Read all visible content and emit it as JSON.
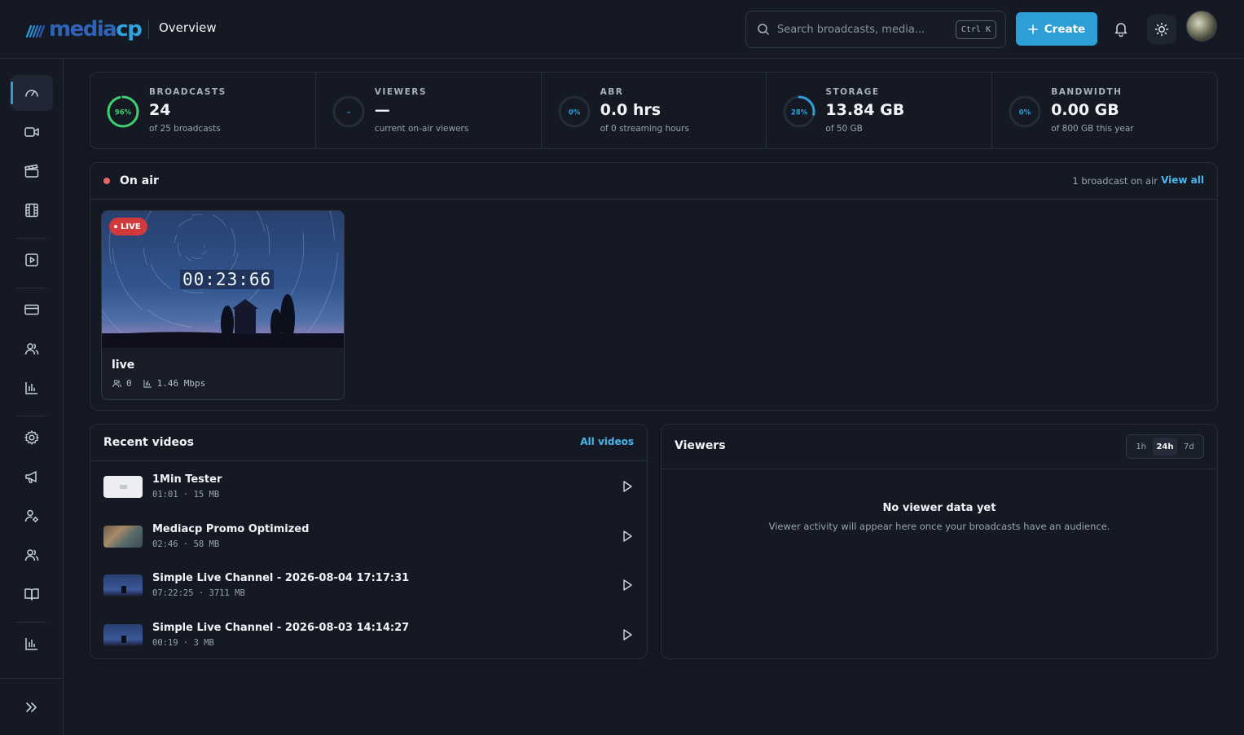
{
  "header": {
    "logo": {
      "part1": "media",
      "part2": "cp"
    },
    "title": "Overview",
    "search_placeholder": "Search broadcasts, media...",
    "shortcut": "Ctrl K",
    "create_label": "Create"
  },
  "sidebar": {
    "items": [
      {
        "icon": "gauge-icon",
        "active": true
      },
      {
        "icon": "video-camera-icon"
      },
      {
        "icon": "clapperboard-icon"
      },
      {
        "icon": "film-icon"
      },
      {
        "icon": "play-square-icon"
      },
      {
        "icon": "credit-card-icon"
      },
      {
        "icon": "users-icon"
      },
      {
        "icon": "bar-chart-icon"
      },
      {
        "icon": "gear-icon"
      },
      {
        "icon": "megaphone-icon"
      },
      {
        "icon": "user-cog-icon"
      },
      {
        "icon": "users-icon"
      },
      {
        "icon": "book-icon"
      },
      {
        "icon": "bar-chart-icon"
      }
    ],
    "collapse_icon": "chevrons-right-icon"
  },
  "stats": [
    {
      "label": "BROADCASTS",
      "value": "24",
      "sub": "of 25 broadcasts",
      "ring": "96%",
      "fraction": 0.96,
      "color": "#3ecf6e"
    },
    {
      "label": "VIEWERS",
      "value": "—",
      "sub": "current on-air viewers",
      "ring": "–",
      "fraction": 0,
      "color": "#2e9fd6"
    },
    {
      "label": "ABR",
      "value": "0.0 hrs",
      "sub": "of 0 streaming hours",
      "ring": "0%",
      "fraction": 0,
      "color": "#2e9fd6"
    },
    {
      "label": "STORAGE",
      "value": "13.84 GB",
      "sub": "of 50 GB",
      "ring": "28%",
      "fraction": 0.28,
      "color": "#2e9fd6"
    },
    {
      "label": "BANDWIDTH",
      "value": "0.00 GB",
      "sub": "of 800 GB this year",
      "ring": "0%",
      "fraction": 0,
      "color": "#2e9fd6"
    }
  ],
  "on_air": {
    "title": "On air",
    "count_text": "1 broadcast on air",
    "view_all": "View all",
    "card": {
      "badge": "LIVE",
      "timer": "00:23:66",
      "name": "live",
      "viewers": "0",
      "bitrate": "1.46 Mbps"
    }
  },
  "recent_videos": {
    "title": "Recent videos",
    "all_link": "All videos",
    "items": [
      {
        "title": "1Min Tester",
        "meta": "01:01 · 15 MB",
        "thumb": "blank"
      },
      {
        "title": "Mediacp Promo Optimized",
        "meta": "02:46 · 58 MB",
        "thumb": "promo"
      },
      {
        "title": "Simple Live Channel - 2026-08-04 17:17:31",
        "meta": "07:22:25 · 3711 MB",
        "thumb": "night"
      },
      {
        "title": "Simple Live Channel - 2026-08-03 14:14:27",
        "meta": "00:19 · 3 MB",
        "thumb": "night"
      }
    ]
  },
  "viewers_panel": {
    "title": "Viewers",
    "ranges": [
      "1h",
      "24h",
      "7d"
    ],
    "active_range": "24h",
    "empty_title": "No viewer data yet",
    "empty_sub": "Viewer activity will appear here once your broadcasts have an audience."
  }
}
